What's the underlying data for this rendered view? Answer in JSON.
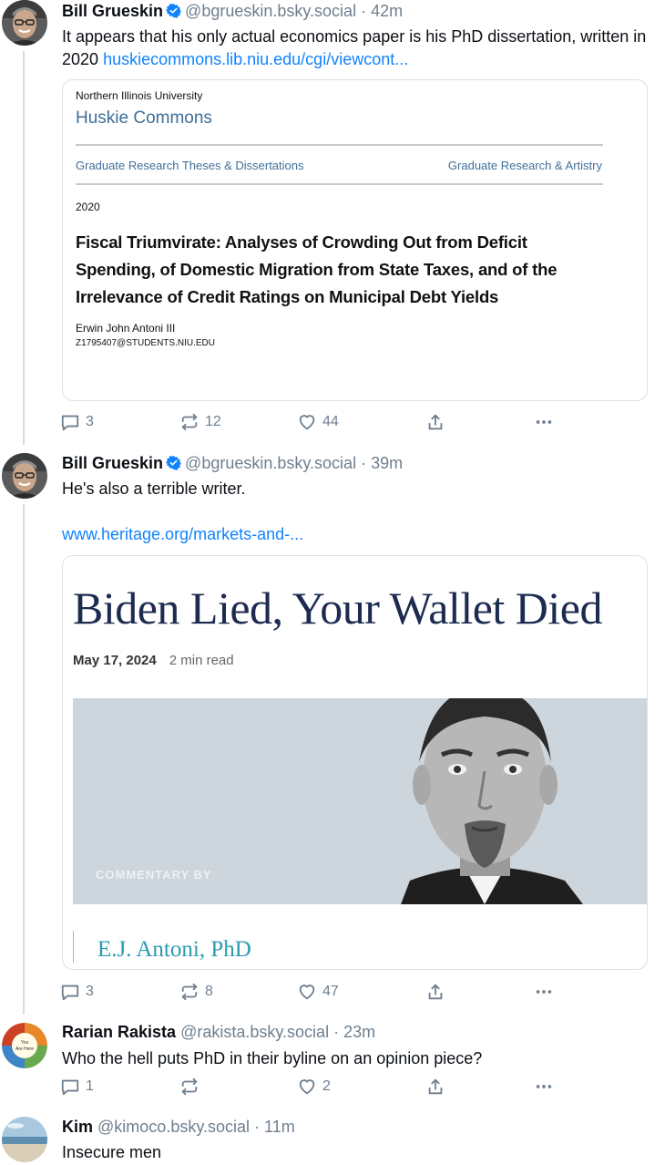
{
  "posts": [
    {
      "author": "Bill Grueskin",
      "handle": "@bgrueskin.bsky.social",
      "time": "42m",
      "text": "It appears that his only actual economics paper is his PhD dissertation, written in 2020",
      "link": "huskiecommons.lib.niu.edu/cgi/viewcont...",
      "card": {
        "institution": "Northern Illinois University",
        "repository": "Huskie Commons",
        "crumb_left": "Graduate Research Theses & Dissertations",
        "crumb_right": "Graduate Research & Artistry",
        "year": "2020",
        "title": "Fiscal Triumvirate: Analyses of Crowding Out from Deficit Spending, of Domestic Migration from State Taxes, and of the Irrelevance of Credit Ratings on Municipal Debt Yields",
        "author_name": "Erwin John Antoni III",
        "author_email": "Z1795407@STUDENTS.NIU.EDU"
      },
      "replies": "3",
      "reposts": "12",
      "likes": "44"
    },
    {
      "author": "Bill Grueskin",
      "handle": "@bgrueskin.bsky.social",
      "time": "39m",
      "text": "He's also a terrible writer.",
      "link": "www.heritage.org/markets-and-...",
      "card": {
        "headline": "Biden Lied, Your Wallet Died",
        "date": "May 17, 2024",
        "read_time": "2 min read",
        "commentary_label": "COMMENTARY BY",
        "byline": "E.J. Antoni, PhD"
      },
      "replies": "3",
      "reposts": "8",
      "likes": "47"
    },
    {
      "author": "Rarian Rakista",
      "handle": "@rakista.bsky.social",
      "time": "23m",
      "text": "Who the hell puts PhD in their byline on an opinion piece?",
      "avatar_text": [
        "You",
        "Are Here"
      ],
      "replies": "1",
      "reposts": "",
      "likes": "2"
    },
    {
      "author": "Kim",
      "handle": "@kimoco.bsky.social",
      "time": "11m",
      "text": "Insecure men"
    }
  ],
  "separator": "·",
  "colors": {
    "link": "#1083fe",
    "muted": "#6f7f8f",
    "verified": "#1083fe",
    "thread_line": "#d4dbe2"
  }
}
